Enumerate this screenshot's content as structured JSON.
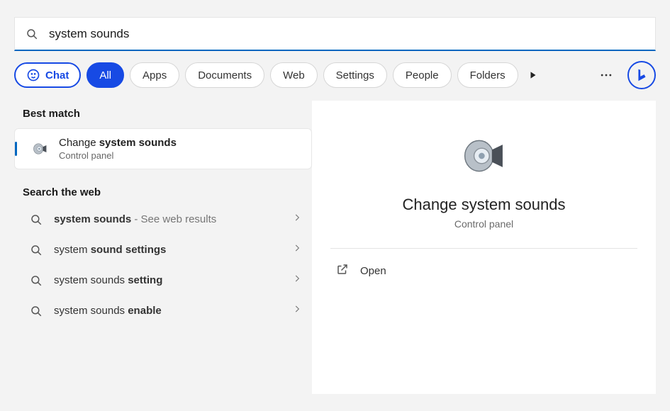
{
  "search": {
    "value": "system sounds"
  },
  "tabs": {
    "chat": "Chat",
    "items": [
      "All",
      "Apps",
      "Documents",
      "Web",
      "Settings",
      "People",
      "Folders"
    ],
    "active_index": 0
  },
  "left": {
    "best_heading": "Best match",
    "best": {
      "title_prefix": "Change ",
      "title_bold": "system sounds",
      "subtitle": "Control panel"
    },
    "web_heading": "Search the web",
    "web_items": [
      {
        "pre": "",
        "bold": "system sounds",
        "post": "",
        "sub": " - See web results"
      },
      {
        "pre": "system ",
        "bold": "sound settings",
        "post": "",
        "sub": ""
      },
      {
        "pre": "system sounds ",
        "bold": "setting",
        "post": "",
        "sub": ""
      },
      {
        "pre": "system sounds ",
        "bold": "enable",
        "post": "",
        "sub": ""
      }
    ]
  },
  "detail": {
    "title": "Change system sounds",
    "subtitle": "Control panel",
    "open_label": "Open"
  }
}
